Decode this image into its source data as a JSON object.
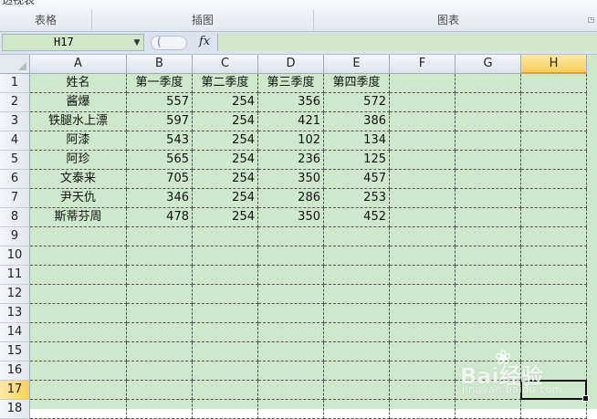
{
  "ribbon": {
    "cut_label": "透视表",
    "groups": [
      {
        "label": "表格"
      },
      {
        "label": "插图"
      },
      {
        "label": "图表"
      }
    ]
  },
  "formula_bar": {
    "name_box": "H17",
    "fx_label": "fx",
    "formula": ""
  },
  "sheet": {
    "columns": [
      "A",
      "B",
      "C",
      "D",
      "E",
      "F",
      "G",
      "H"
    ],
    "selected_column": "H",
    "rows": [
      "1",
      "2",
      "3",
      "4",
      "5",
      "6",
      "7",
      "8",
      "9",
      "10",
      "11",
      "12",
      "13",
      "14",
      "15",
      "16",
      "17",
      "18"
    ],
    "selected_row": "17",
    "headers": [
      "姓名",
      "第一季度",
      "第二季度",
      "第三季度",
      "第四季度"
    ],
    "data": [
      [
        "酱爆",
        "557",
        "254",
        "356",
        "572"
      ],
      [
        "铁腿水上漂",
        "597",
        "254",
        "421",
        "386"
      ],
      [
        "阿漆",
        "543",
        "254",
        "102",
        "134"
      ],
      [
        "阿珍",
        "565",
        "254",
        "236",
        "125"
      ],
      [
        "文泰来",
        "705",
        "254",
        "350",
        "457"
      ],
      [
        "尹天仇",
        "346",
        "254",
        "286",
        "253"
      ],
      [
        "斯蒂芬周",
        "478",
        "254",
        "350",
        "452"
      ]
    ],
    "active_cell": "H17",
    "cell_bg": "#cde8ca"
  },
  "watermark": {
    "brand": "Bai经验",
    "url": "jingyan.baidu.com"
  }
}
